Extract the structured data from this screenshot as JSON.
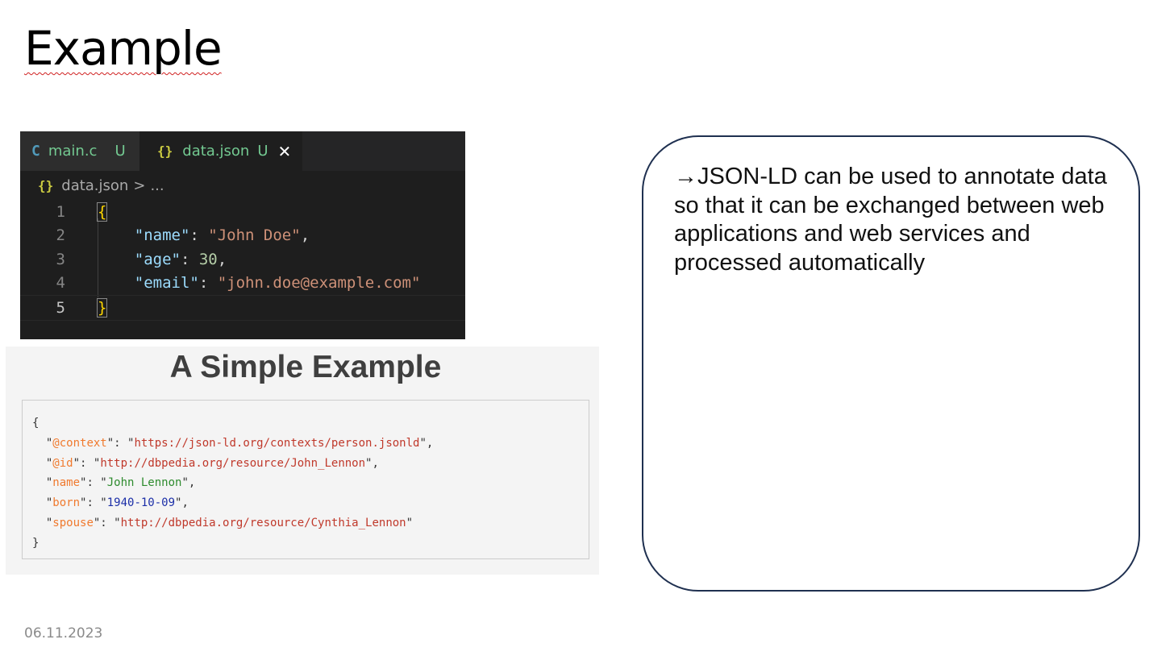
{
  "slide": {
    "title": "Example",
    "date": "06.11.2023"
  },
  "editor": {
    "tabs": [
      {
        "icon": "C",
        "label": "main.c",
        "status": "U"
      },
      {
        "icon": "{}",
        "label": "data.json",
        "status": "U",
        "close": "✕"
      }
    ],
    "breadcrumb": {
      "icon": "{}",
      "file": "data.json",
      "separator": ">",
      "more": "..."
    },
    "lines": [
      {
        "number": "1"
      },
      {
        "number": "2",
        "key": "\"name\"",
        "value": "\"John Doe\""
      },
      {
        "number": "3",
        "key": "\"age\"",
        "value": "30"
      },
      {
        "number": "4",
        "key": "\"email\"",
        "value": "\"john.doe@example.com\""
      },
      {
        "number": "5"
      }
    ],
    "open_brace": "{",
    "close_brace": "}",
    "colon": ": ",
    "comma": ","
  },
  "jsonld": {
    "title": "A Simple Example",
    "open_brace": "{",
    "close_brace": "}",
    "rows": [
      {
        "key": "@context",
        "value": "https://json-ld.org/contexts/person.jsonld"
      },
      {
        "key": "@id",
        "value": "http://dbpedia.org/resource/John_Lennon"
      },
      {
        "key": "name",
        "value": "John Lennon"
      },
      {
        "key": "born",
        "value": "1940-10-09"
      },
      {
        "key": "spouse",
        "value": "http://dbpedia.org/resource/Cynthia_Lennon"
      }
    ]
  },
  "textbox": {
    "text": "→JSON-LD can be used to annotate data so that it can be exchanged between web applications and web services and processed automatically"
  }
}
